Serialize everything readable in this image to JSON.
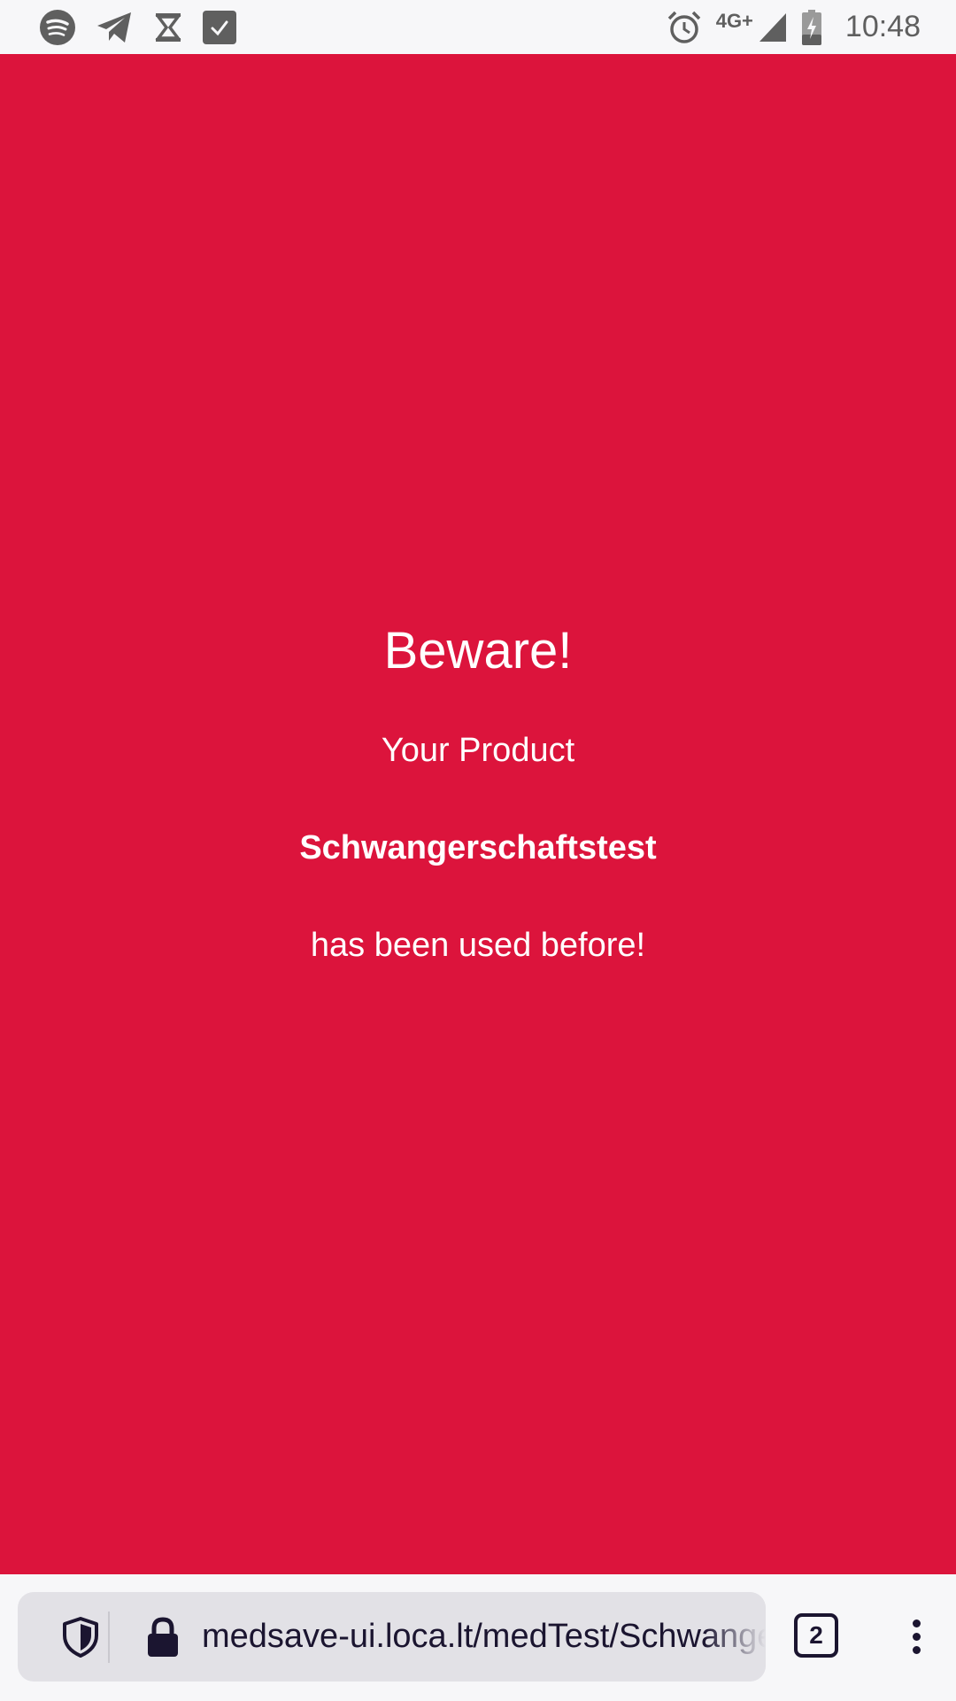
{
  "status_bar": {
    "network": "4G+",
    "time": "10:48"
  },
  "alert": {
    "title": "Beware!",
    "line1": "Your Product",
    "product": "Schwangerschaftstest",
    "line2": "has been used before!",
    "background_color": "#dc143c"
  },
  "browser": {
    "url": "medsave-ui.loca.lt/medTest/Schwangerschaftstest",
    "tab_count": "2"
  }
}
